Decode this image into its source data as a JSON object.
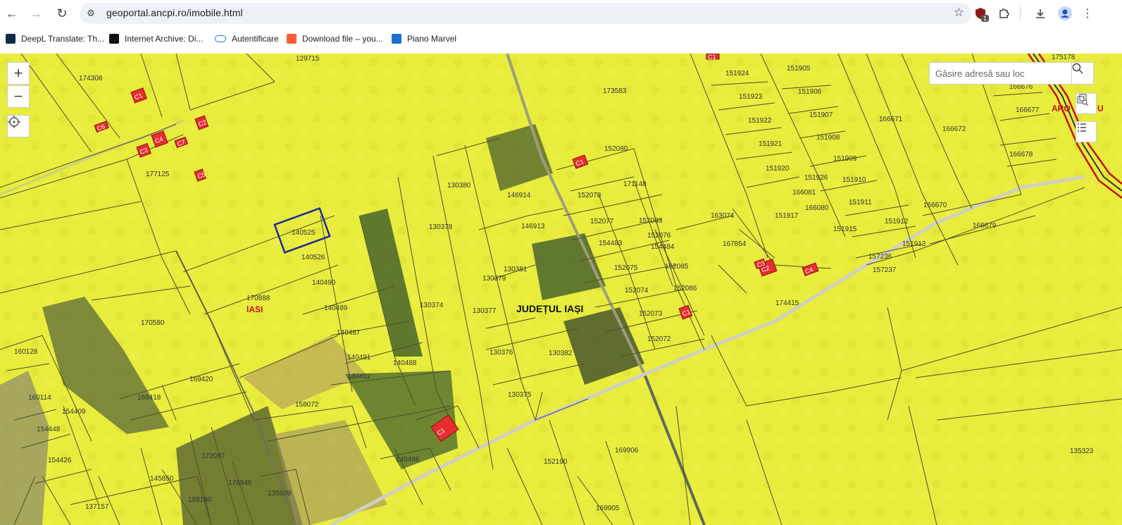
{
  "browser": {
    "url": "geoportal.ancpi.ro/imobile.html",
    "extension_badge": "1",
    "bookmarks": [
      {
        "label": "DeepL Translate: Th...",
        "icon": "deepl-icon"
      },
      {
        "label": "Internet Archive: Di...",
        "icon": "archive-icon"
      },
      {
        "label": "Autentificare",
        "icon": "link-icon"
      },
      {
        "label": "Download file – you...",
        "icon": "download-site-icon"
      },
      {
        "label": "Piano Marvel",
        "icon": "piano-icon"
      }
    ]
  },
  "map": {
    "search_placeholder": "Găsire adresă sau loc",
    "zoom_in": "+",
    "zoom_out": "−",
    "county_label": "JUDEȚUL IAȘI",
    "locality_label": "IASI",
    "road_label": "ARO",
    "road_label_suffix": "U",
    "colors": {
      "parcel_fill": "#e8ec3c",
      "parcel_line": "#5a5a2a",
      "building": "#e62e2e",
      "selected_outline": "#1c2a9a",
      "road": "#c8c8b8"
    },
    "parcels": [
      "129715",
      "174308",
      "173583",
      "151924",
      "151905",
      "175178",
      "151923",
      "151906",
      "166676",
      "166677",
      "151907",
      "166671",
      "166672",
      "151922",
      "151908",
      "151921",
      "151909",
      "166678",
      "151920",
      "151926",
      "151910",
      "166081",
      "151911",
      "166670",
      "166080",
      "151912",
      "151917",
      "151915",
      "151913",
      "166679",
      "163074",
      "167854",
      "157236",
      "157237",
      "174415",
      "152080",
      "171148",
      "152078",
      "146914",
      "152077",
      "152083",
      "152076",
      "154483",
      "154484",
      "152075",
      "152085",
      "152074",
      "152086",
      "152073",
      "152072",
      "130380",
      "130378",
      "146913",
      "130381",
      "130379",
      "130374",
      "130377",
      "130376",
      "130382",
      "130375",
      "140525",
      "140526",
      "140490",
      "140489",
      "140487",
      "140491",
      "140488",
      "140492",
      "170888",
      "170580",
      "160128",
      "160114",
      "169420",
      "169418",
      "154409",
      "154448",
      "154426",
      "158072",
      "140486",
      "152190",
      "169906",
      "169905",
      "135323",
      "145850",
      "172087",
      "176946",
      "168180",
      "137157",
      "135509",
      "177125"
    ],
    "buildings": [
      "C1",
      "C2",
      "C3",
      "C4",
      "C5",
      "C6",
      "C7",
      "C1",
      "C1",
      "C2",
      "C3",
      "C4",
      "C1",
      "C1"
    ]
  }
}
